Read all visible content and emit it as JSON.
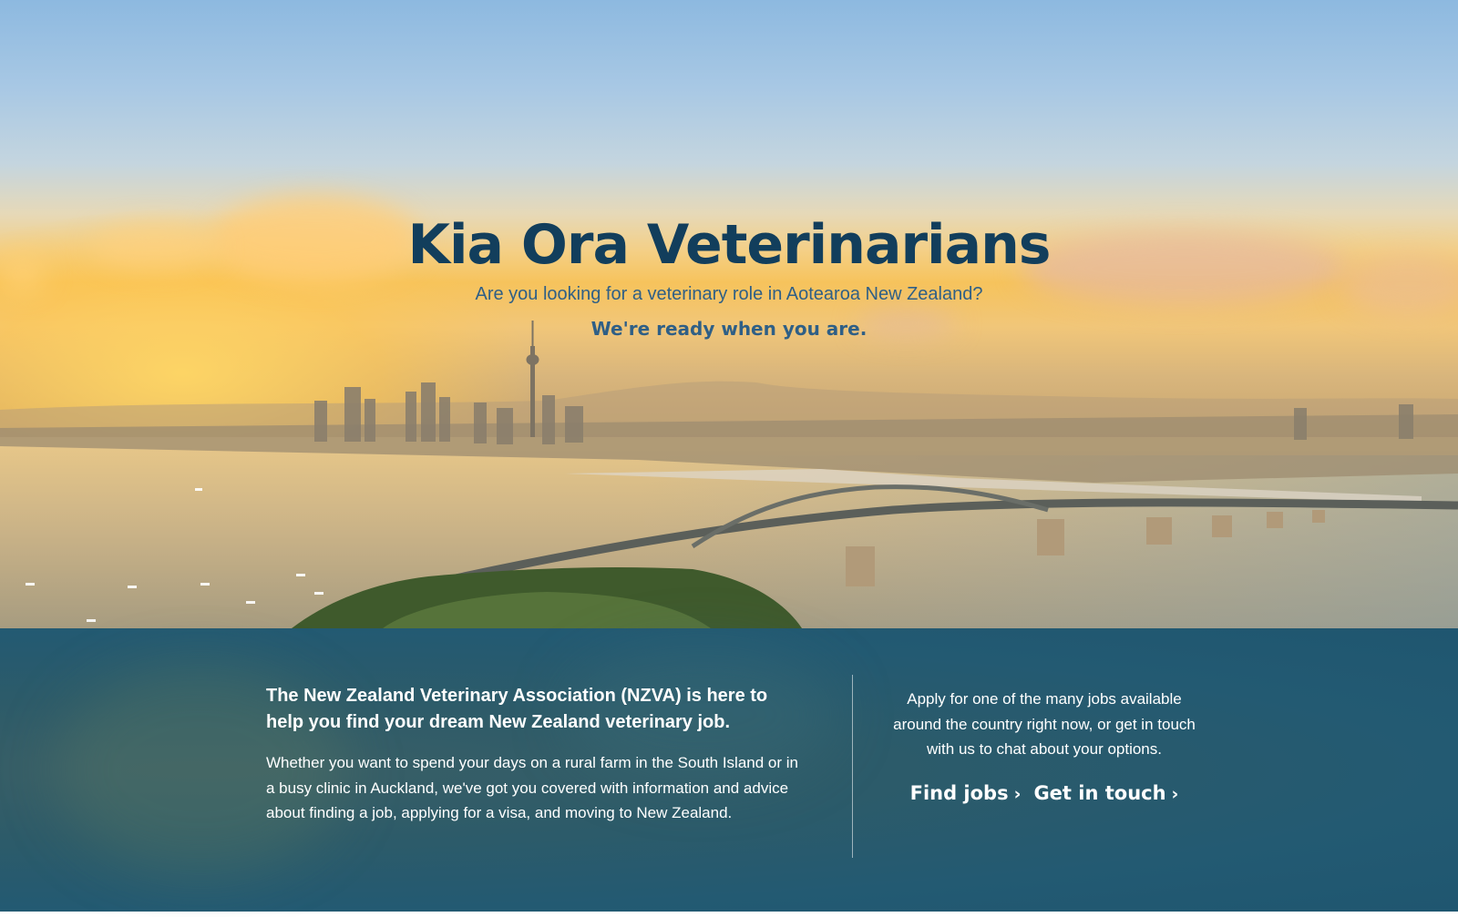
{
  "hero": {
    "title": "Kia Ora Veterinarians",
    "subtitle": "Are you looking for a veterinary role in Aotearoa New Zealand?",
    "tagline": "We're ready when you are."
  },
  "info": {
    "lead": "The New Zealand Veterinary Association (NZVA) is here to help you find your dream New Zealand veterinary job.",
    "body": "Whether you want to spend your days on a rural farm in the South Island or in a busy clinic in Auckland, we've got you covered with information and advice about finding a job, applying for a visa, and moving to New Zealand.",
    "apply_text": "Apply for one of the many jobs available around the country right now, or get in touch with us to chat about your options.",
    "find_jobs_label": "Find jobs",
    "get_in_touch_label": "Get in touch",
    "chevron": "›"
  },
  "colors": {
    "title": "#123e5c",
    "subtitle": "#2f5f86",
    "panel": "#235a72"
  },
  "icons": {
    "find_jobs": "chevron-right-icon",
    "get_in_touch": "chevron-right-icon"
  }
}
